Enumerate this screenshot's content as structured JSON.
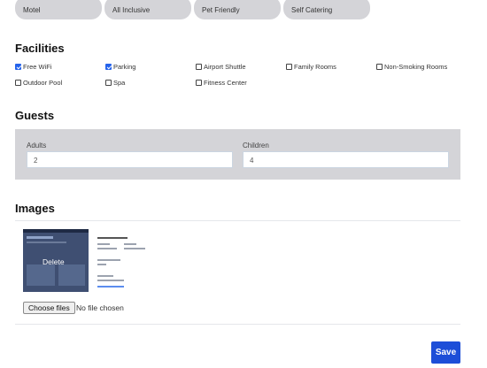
{
  "type_options": [
    "Motel",
    "All Inclusive",
    "Pet Friendly",
    "Self Catering"
  ],
  "facilities": {
    "title": "Facilities",
    "items": [
      {
        "label": "Free WiFi",
        "checked": true
      },
      {
        "label": "Parking",
        "checked": true
      },
      {
        "label": "Airport Shuttle",
        "checked": false
      },
      {
        "label": "Family Rooms",
        "checked": false
      },
      {
        "label": "Non-Smoking Rooms",
        "checked": false
      },
      {
        "label": "Outdoor Pool",
        "checked": false
      },
      {
        "label": "Spa",
        "checked": false
      },
      {
        "label": "Fitness Center",
        "checked": false
      }
    ]
  },
  "guests": {
    "title": "Guests",
    "adults_label": "Adults",
    "adults_value": "2",
    "children_label": "Children",
    "children_value": "4"
  },
  "images": {
    "title": "Images",
    "delete_label": "Delete",
    "choose_files_label": "Choose files",
    "file_status": "No file chosen"
  },
  "save_label": "Save"
}
